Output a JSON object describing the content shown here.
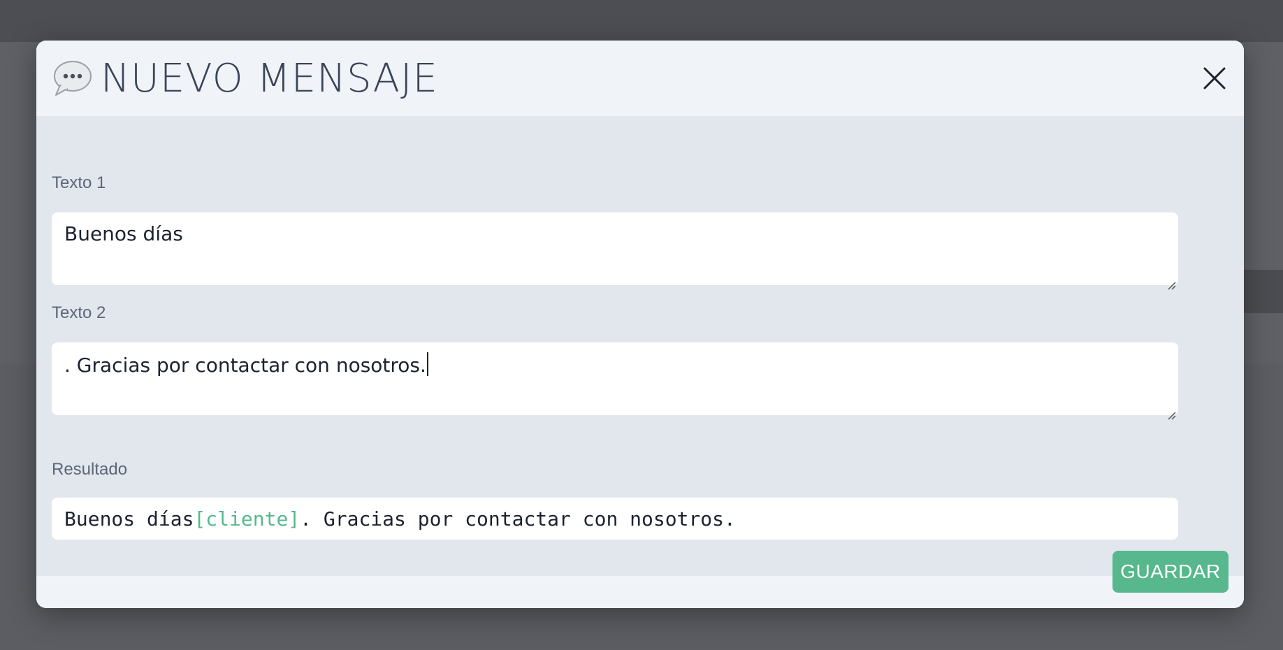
{
  "modal": {
    "title": "NUEVO MENSAJE",
    "icon": "speech-bubble-icon",
    "close_icon": "close-icon"
  },
  "fields": {
    "texto1": {
      "label": "Texto 1",
      "value": "Buenos días"
    },
    "texto2": {
      "label": "Texto 2",
      "value": ". Gracias por contactar con nosotros."
    }
  },
  "result": {
    "label": "Resultado",
    "prefix": "Buenos días",
    "placeholder": "[cliente]",
    "suffix": ". Gracias por contactar con nosotros."
  },
  "footer": {
    "save_label": "GUARDAR"
  },
  "colors": {
    "accent": "#56b88c",
    "title": "#3b4458",
    "overlay": "#5b5d62"
  }
}
